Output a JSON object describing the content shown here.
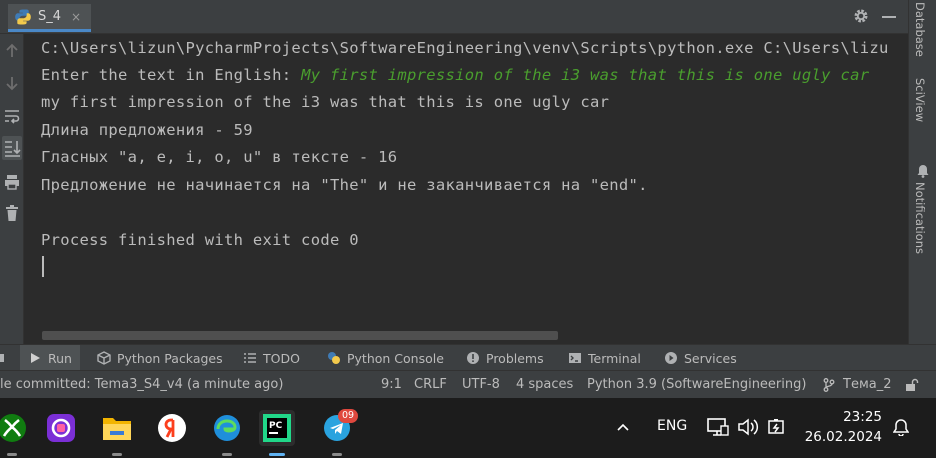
{
  "run_tab": {
    "label": "S_4",
    "close": "×"
  },
  "console": {
    "lines": [
      "C:\\Users\\lizun\\PycharmProjects\\SoftwareEngineering\\venv\\Scripts\\python.exe C:\\Users\\lizu",
      "Enter the text in English: ",
      "my first impression of the i3 was that this is one ugly car",
      "Длина предложения - 59",
      "Гласных \"a, e, i, o, u\" в тексте - 16",
      "Предложение не начинается на \"The\" и не заканчивается на \"end\".",
      "Process finished with exit code 0"
    ],
    "user_input": "My first impression of the i3 was that this is one ugly car"
  },
  "right_strip": {
    "database": "Database",
    "sciview": "SciView",
    "notifications": "Notifications"
  },
  "tool_tabs": {
    "run": "Run",
    "python_packages": "Python Packages",
    "todo": "TODO",
    "python_console": "Python Console",
    "problems": "Problems",
    "terminal": "Terminal",
    "services": "Services"
  },
  "status_bar": {
    "message": "le committed: Tema3_S4_v4 (a minute ago)",
    "position": "9:1",
    "line_sep": "CRLF",
    "encoding": "UTF-8",
    "indent": "4 spaces",
    "interpreter": "Python 3.9 (SoftwareEngineering)",
    "branch": "Тема_2"
  },
  "taskbar": {
    "telegram_badge": "09",
    "language": "ENG",
    "time": "23:25",
    "date": "26.02.2024"
  },
  "colors": {
    "accent": "#4a88c7",
    "input_text": "#4a9e2e",
    "console_bg": "#2b2b2b"
  }
}
